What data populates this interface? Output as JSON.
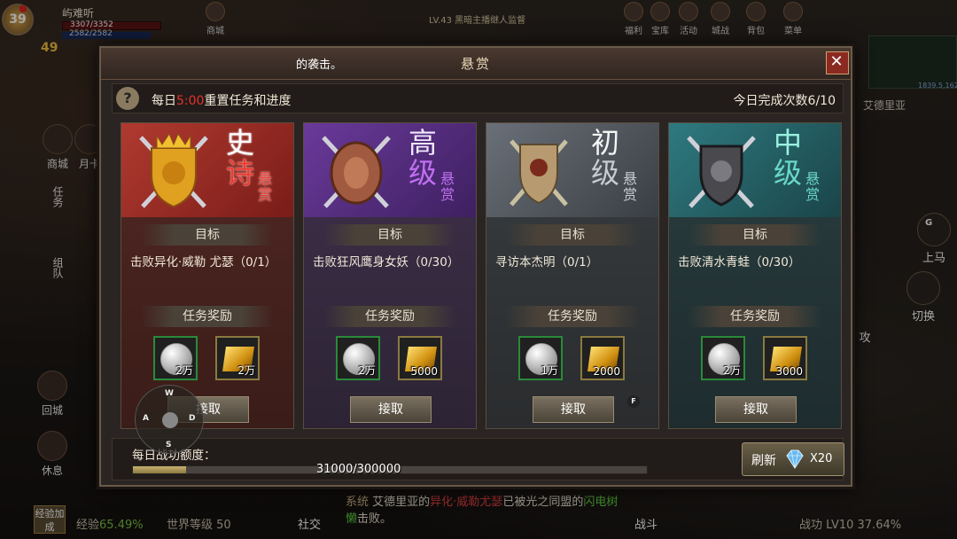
{
  "hud": {
    "player_level_badge": "39",
    "player_name": "屿难听",
    "hp_text": "3307/3352",
    "mp_text": "2582/2582",
    "level_badge": "49",
    "top_center": "LV.43 黑暗主播继人监督",
    "top_icons": [
      "商城",
      "福利",
      "宝库",
      "活动",
      "城战",
      "背包",
      "菜单"
    ],
    "coord": "1839.5,1620",
    "location": "艾德里亚",
    "side_left": [
      "商城",
      "月卡",
      "任务",
      "组队",
      "回城",
      "休息"
    ],
    "side_right": [
      "上马",
      "切换",
      "攻"
    ],
    "minimap_key": "G",
    "exp_button": "经验加成",
    "exp_label": "经验",
    "exp_value": "65.49%",
    "world_level": "世界等级 50",
    "social": "社交",
    "battle": "战斗",
    "battle_level": "战功 LV10 37.64%",
    "chat": {
      "tag": "系统",
      "prefix": "艾德里亚的",
      "red_text": "异化·威勒尤瑟",
      "mid": "已被光之同盟的",
      "green_text": "闪电树懒",
      "suffix": "击败。"
    },
    "dpad": {
      "up": "W",
      "left": "A",
      "right": "D",
      "down": "S"
    }
  },
  "dialog": {
    "title": "悬赏",
    "marquee": "的袭击。",
    "close_icon": "✕",
    "help": "?",
    "reset_prefix": "每日",
    "reset_time": "5:00",
    "reset_suffix": "重置任务和进度",
    "completed": "今日完成次数6/10",
    "goal_header": "目标",
    "reward_header": "任务奖励",
    "claim_label": "接取",
    "cards": [
      {
        "rank1": "史",
        "rank2": "诗",
        "bounty": "悬赏",
        "goal": "击败异化·威勒 尤瑟（0/1）",
        "silver": "2万",
        "gold": "2万",
        "theme": "red"
      },
      {
        "rank1": "高",
        "rank2": "级",
        "bounty": "悬赏",
        "goal": "击败狂风鹰身女妖（0/30）",
        "silver": "2万",
        "gold": "5000",
        "theme": "purple"
      },
      {
        "rank1": "初",
        "rank2": "级",
        "bounty": "悬赏",
        "goal": "寻访本杰明（0/1）",
        "silver": "1万",
        "gold": "2000",
        "theme": "grey"
      },
      {
        "rank1": "中",
        "rank2": "级",
        "bounty": "悬赏",
        "goal": "击败清水青蛙（0/30）",
        "silver": "2万",
        "gold": "3000",
        "theme": "teal"
      }
    ],
    "f_badge": "F",
    "quota_label": "每日战功额度：",
    "quota_value": "31000/300000",
    "quota_fraction": 0.103,
    "refresh_label": "刷新",
    "refresh_count": "X20"
  }
}
